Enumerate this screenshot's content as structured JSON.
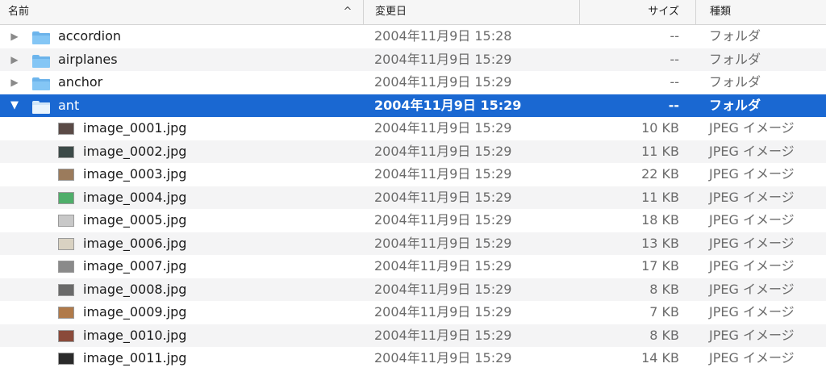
{
  "header": {
    "name": "名前",
    "date": "変更日",
    "size": "サイズ",
    "kind": "種類",
    "sort_icon": "^"
  },
  "icons": {
    "collapsed": "▶",
    "expanded": "▼"
  },
  "rows": [
    {
      "type": "folder",
      "name": "accordion",
      "date": "2004年11月9日 15:28",
      "size": "--",
      "kind": "フォルダ",
      "expanded": false,
      "selected": false
    },
    {
      "type": "folder",
      "name": "airplanes",
      "date": "2004年11月9日 15:29",
      "size": "--",
      "kind": "フォルダ",
      "expanded": false,
      "selected": false
    },
    {
      "type": "folder",
      "name": "anchor",
      "date": "2004年11月9日 15:29",
      "size": "--",
      "kind": "フォルダ",
      "expanded": false,
      "selected": false
    },
    {
      "type": "folder",
      "name": "ant",
      "date": "2004年11月9日 15:29",
      "size": "--",
      "kind": "フォルダ",
      "expanded": true,
      "selected": true
    },
    {
      "type": "file",
      "name": "image_0001.jpg",
      "date": "2004年11月9日 15:29",
      "size": "10 KB",
      "kind": "JPEG イメージ",
      "thumb": "#5a4a46"
    },
    {
      "type": "file",
      "name": "image_0002.jpg",
      "date": "2004年11月9日 15:29",
      "size": "11 KB",
      "kind": "JPEG イメージ",
      "thumb": "#3c4a48"
    },
    {
      "type": "file",
      "name": "image_0003.jpg",
      "date": "2004年11月9日 15:29",
      "size": "22 KB",
      "kind": "JPEG イメージ",
      "thumb": "#9b7b5c"
    },
    {
      "type": "file",
      "name": "image_0004.jpg",
      "date": "2004年11月9日 15:29",
      "size": "11 KB",
      "kind": "JPEG イメージ",
      "thumb": "#4fae6a"
    },
    {
      "type": "file",
      "name": "image_0005.jpg",
      "date": "2004年11月9日 15:29",
      "size": "18 KB",
      "kind": "JPEG イメージ",
      "thumb": "#c8c8c8"
    },
    {
      "type": "file",
      "name": "image_0006.jpg",
      "date": "2004年11月9日 15:29",
      "size": "13 KB",
      "kind": "JPEG イメージ",
      "thumb": "#d9d2c2"
    },
    {
      "type": "file",
      "name": "image_0007.jpg",
      "date": "2004年11月9日 15:29",
      "size": "17 KB",
      "kind": "JPEG イメージ",
      "thumb": "#8a8a8a"
    },
    {
      "type": "file",
      "name": "image_0008.jpg",
      "date": "2004年11月9日 15:29",
      "size": "8 KB",
      "kind": "JPEG イメージ",
      "thumb": "#6a6a6a"
    },
    {
      "type": "file",
      "name": "image_0009.jpg",
      "date": "2004年11月9日 15:29",
      "size": "7 KB",
      "kind": "JPEG イメージ",
      "thumb": "#b07a4a"
    },
    {
      "type": "file",
      "name": "image_0010.jpg",
      "date": "2004年11月9日 15:29",
      "size": "8 KB",
      "kind": "JPEG イメージ",
      "thumb": "#8a4a3a"
    },
    {
      "type": "file",
      "name": "image_0011.jpg",
      "date": "2004年11月9日 15:29",
      "size": "14 KB",
      "kind": "JPEG イメージ",
      "thumb": "#2a2a2a"
    }
  ]
}
